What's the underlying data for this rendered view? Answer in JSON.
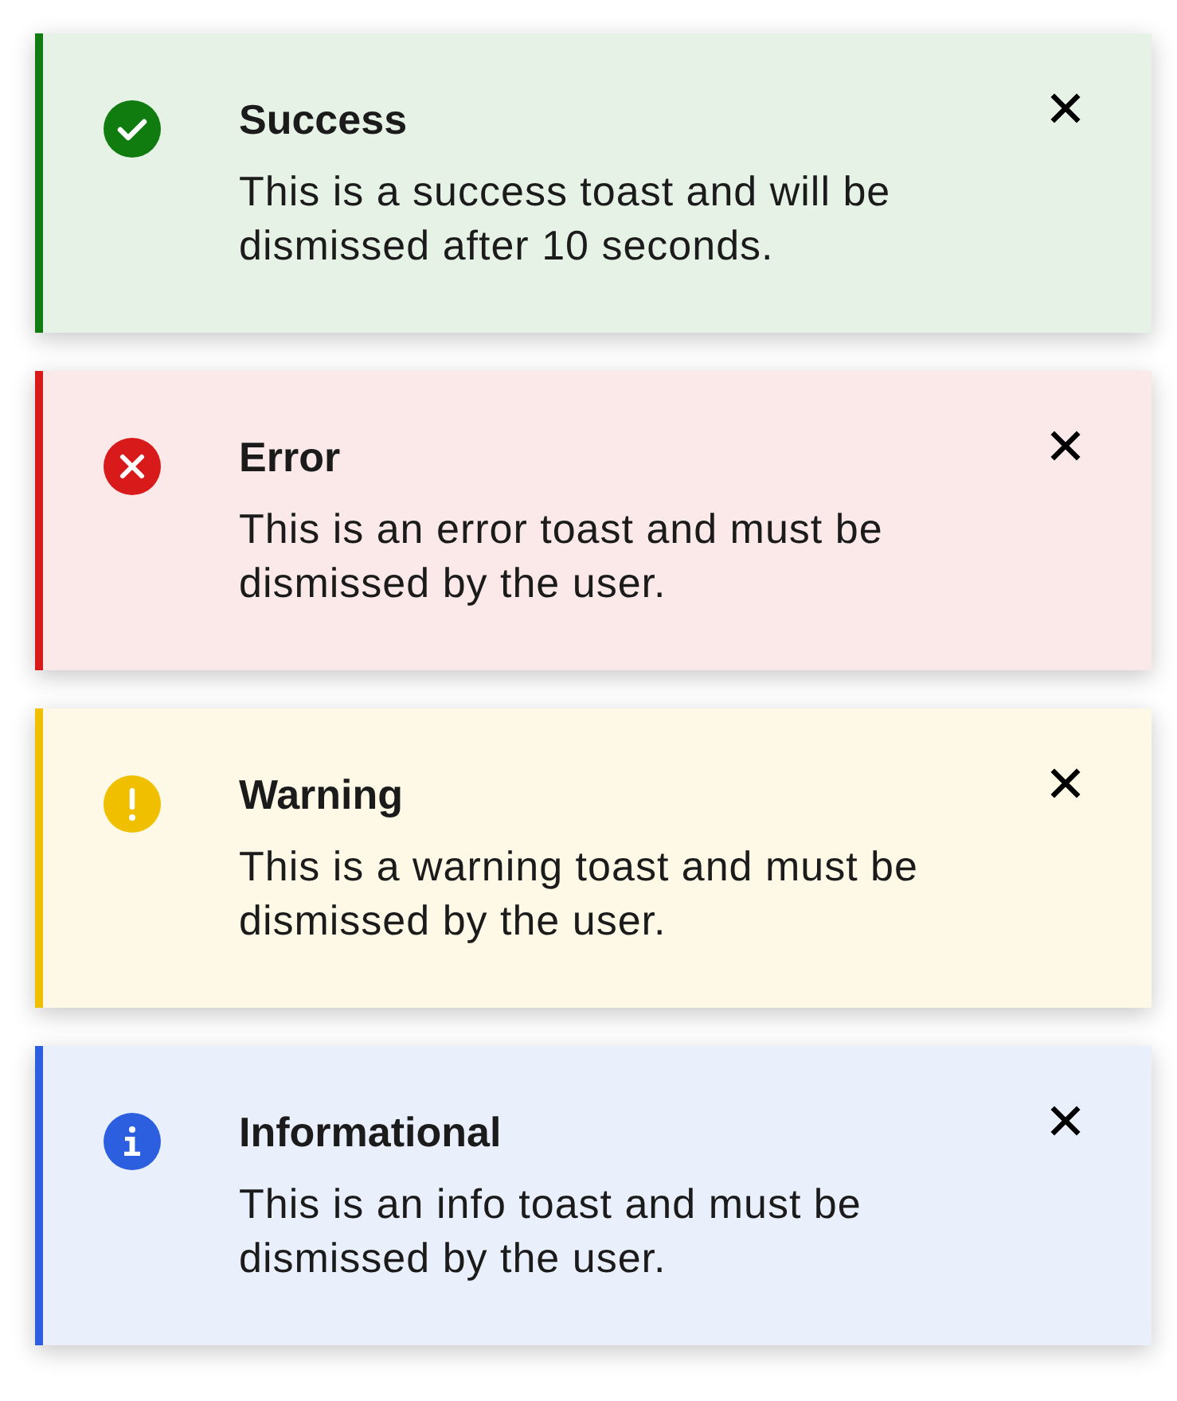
{
  "toasts": [
    {
      "kind": "success",
      "color": "#107c10",
      "title": "Success",
      "message": "This is a success toast and will be dismissed after 10 seconds."
    },
    {
      "kind": "error",
      "color": "#d91a1a",
      "title": "Error",
      "message": "This is an error toast and must be dismissed by the user."
    },
    {
      "kind": "warning",
      "color": "#f0c000",
      "title": "Warning",
      "message": "This is a warning toast and must be dismissed by the user."
    },
    {
      "kind": "info",
      "color": "#2b5fe0",
      "title": "Informational",
      "message": "This is an info toast and must be dismissed by the user."
    }
  ]
}
